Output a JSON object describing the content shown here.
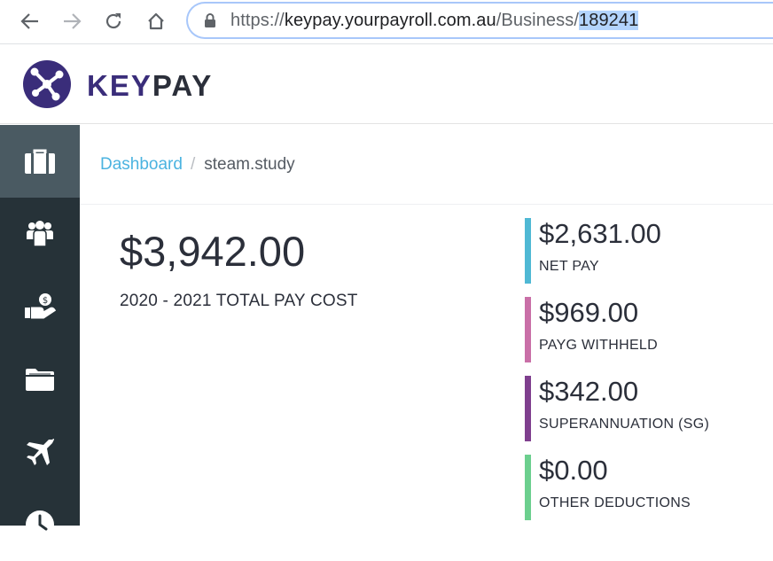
{
  "browser": {
    "url_prefix": "https://",
    "url_host": "keypay.yourpayroll.com.au",
    "url_path": "/Business/",
    "url_selected": "189241"
  },
  "brand": {
    "name_part1": "KEY",
    "name_part2": "PAY",
    "accent_color": "#3a2d7a"
  },
  "sidebar": {
    "items": [
      {
        "icon": "briefcase-icon",
        "active": true
      },
      {
        "icon": "people-icon",
        "active": false
      },
      {
        "icon": "hand-money-icon",
        "active": false
      },
      {
        "icon": "folder-icon",
        "active": false
      },
      {
        "icon": "airplane-icon",
        "active": false
      },
      {
        "icon": "clock-icon",
        "active": false
      }
    ]
  },
  "breadcrumb": {
    "link": "Dashboard",
    "separator": "/",
    "current": "steam.study"
  },
  "summary": {
    "total_value": "$3,942.00",
    "total_label": "2020 - 2021 TOTAL PAY COST"
  },
  "stats": [
    {
      "value": "$2,631.00",
      "label": "NET PAY",
      "color": "#4fb8d4"
    },
    {
      "value": "$969.00",
      "label": "PAYG WITHHELD",
      "color": "#c96fa7"
    },
    {
      "value": "$342.00",
      "label": "SUPERANNUATION (SG)",
      "color": "#7f3f8e"
    },
    {
      "value": "$0.00",
      "label": "OTHER DEDUCTIONS",
      "color": "#6ccf8e"
    }
  ]
}
